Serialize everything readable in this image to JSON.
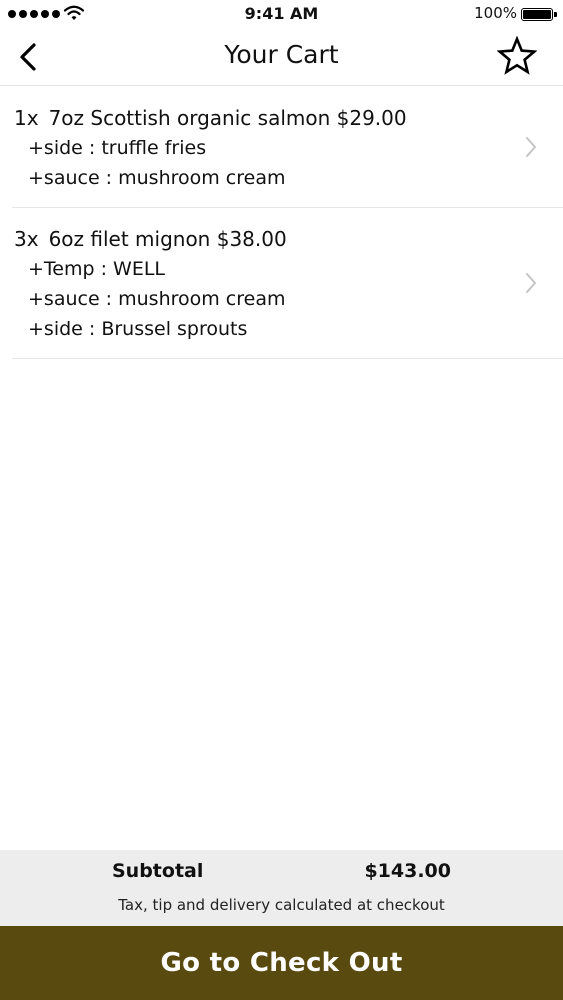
{
  "status_bar": {
    "time": "9:41 AM",
    "battery_percent": "100%",
    "battery_level": 1.0,
    "signal_icon": "signal-dots-icon",
    "wifi_icon": "wifi-icon"
  },
  "nav": {
    "title": "Your Cart",
    "back_icon": "chevron-left-icon",
    "favorite_icon": "star-outline-icon"
  },
  "cart": {
    "items": [
      {
        "quantity": "1x",
        "name": "7oz Scottish organic salmon $29.00",
        "options": [
          "+side : truffle fries",
          "+sauce : mushroom cream"
        ]
      },
      {
        "quantity": "3x",
        "name": "6oz filet mignon $38.00",
        "options": [
          "+Temp : WELL",
          "+sauce : mushroom cream",
          "+side : Brussel sprouts"
        ]
      }
    ]
  },
  "summary": {
    "subtotal_label": "Subtotal",
    "subtotal_value": "$143.00",
    "note": "Tax, tip and delivery calculated at checkout"
  },
  "checkout": {
    "label": "Go to Check Out"
  },
  "colors": {
    "checkout_bg": "#594a10",
    "summary_bg": "#ededed",
    "divider": "#e6e6e6",
    "chevron": "#c4c4c4"
  }
}
